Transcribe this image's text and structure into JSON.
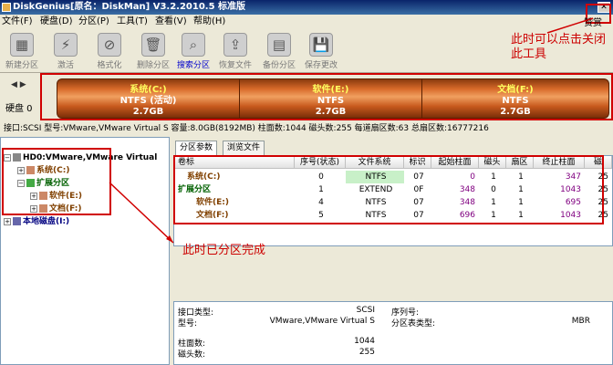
{
  "window": {
    "title": "DiskGenius[原名：DiskMan] V3.2.2010.5 标准版"
  },
  "menu": [
    "文件(F)",
    "硬盘(D)",
    "分区(P)",
    "工具(T)",
    "查看(V)",
    "帮助(H)"
  ],
  "toolbar": [
    {
      "label": "新建分区",
      "icon": "new-partition-icon",
      "glyph": "▦"
    },
    {
      "label": "激活",
      "icon": "activate-icon",
      "glyph": "⚡"
    },
    {
      "label": "格式化",
      "icon": "format-icon",
      "glyph": "⊘"
    },
    {
      "label": "删除分区",
      "icon": "delete-partition-icon",
      "glyph": "🗑"
    },
    {
      "label": "搜索分区",
      "icon": "search-partition-icon",
      "glyph": "⌕"
    },
    {
      "label": "恢复文件",
      "icon": "recover-file-icon",
      "glyph": "⇪"
    },
    {
      "label": "备份分区",
      "icon": "backup-partition-icon",
      "glyph": "▤"
    },
    {
      "label": "保存更改",
      "icon": "save-changes-icon",
      "glyph": "💾"
    }
  ],
  "annotations": {
    "top": "此时可以点击关闭此工具",
    "middle": "此时已分区完成",
    "corner": "赞赏"
  },
  "diskbar": {
    "disk_label": "硬盘 0",
    "nav": "◀ ▶",
    "partitions": [
      {
        "name": "系统(C:)",
        "fs": "NTFS (活动)",
        "size": "2.7GB"
      },
      {
        "name": "软件(E:)",
        "fs": "NTFS",
        "size": "2.7GB"
      },
      {
        "name": "文档(F:)",
        "fs": "NTFS",
        "size": "2.7GB"
      }
    ]
  },
  "infoline": "接口:SCSI  型号:VMware,VMware Virtual S  容量:8.0GB(8192MB)  柱面数:1044  磁头数:255  每道扇区数:63  总扇区数:16777216",
  "tree": {
    "disk": "HD0:VMware,VMware Virtual",
    "items": [
      {
        "label": "系统(C:)",
        "indent": 1
      },
      {
        "label": "扩展分区",
        "indent": 1
      },
      {
        "label": "软件(E:)",
        "indent": 2
      },
      {
        "label": "文档(F:)",
        "indent": 2
      }
    ],
    "local": "本地磁盘(I:)"
  },
  "tabs": [
    "分区参数",
    "浏览文件"
  ],
  "grid": {
    "headers": [
      "卷标",
      "序号(状态)",
      "文件系统",
      "标识",
      "起始柱面",
      "磁头",
      "扇区",
      "终止柱面",
      "磁"
    ],
    "rows": [
      {
        "label": "系统(C:)",
        "num": "0",
        "fs": "NTFS",
        "id": "07",
        "start": "0",
        "head": "1",
        "sector": "1",
        "end": "347",
        "x": "25"
      },
      {
        "label": "扩展分区",
        "num": "1",
        "fs": "EXTEND",
        "id": "0F",
        "start": "348",
        "head": "0",
        "sector": "1",
        "end": "1043",
        "x": "25"
      },
      {
        "label": "软件(E:)",
        "num": "4",
        "fs": "NTFS",
        "id": "07",
        "start": "348",
        "head": "1",
        "sector": "1",
        "end": "695",
        "x": "25"
      },
      {
        "label": "文档(F:)",
        "num": "5",
        "fs": "NTFS",
        "id": "07",
        "start": "696",
        "head": "1",
        "sector": "1",
        "end": "1043",
        "x": "25"
      }
    ]
  },
  "details": {
    "iface_label": "接口类型:",
    "iface_value": "SCSI",
    "model_label": "型号:",
    "model_value": "VMware,VMware Virtual S",
    "serial_label": "序列号:",
    "pt_label": "分区表类型:",
    "pt_value": "MBR",
    "cyl_label": "柱面数:",
    "cyl_value": "1044",
    "head_label": "磁头数:",
    "head_value": "255"
  },
  "colors": {
    "accent": "#d00000",
    "title_bg": "#0a246a",
    "cylinder": "#d86a2a",
    "part_text": "#ffff60"
  }
}
